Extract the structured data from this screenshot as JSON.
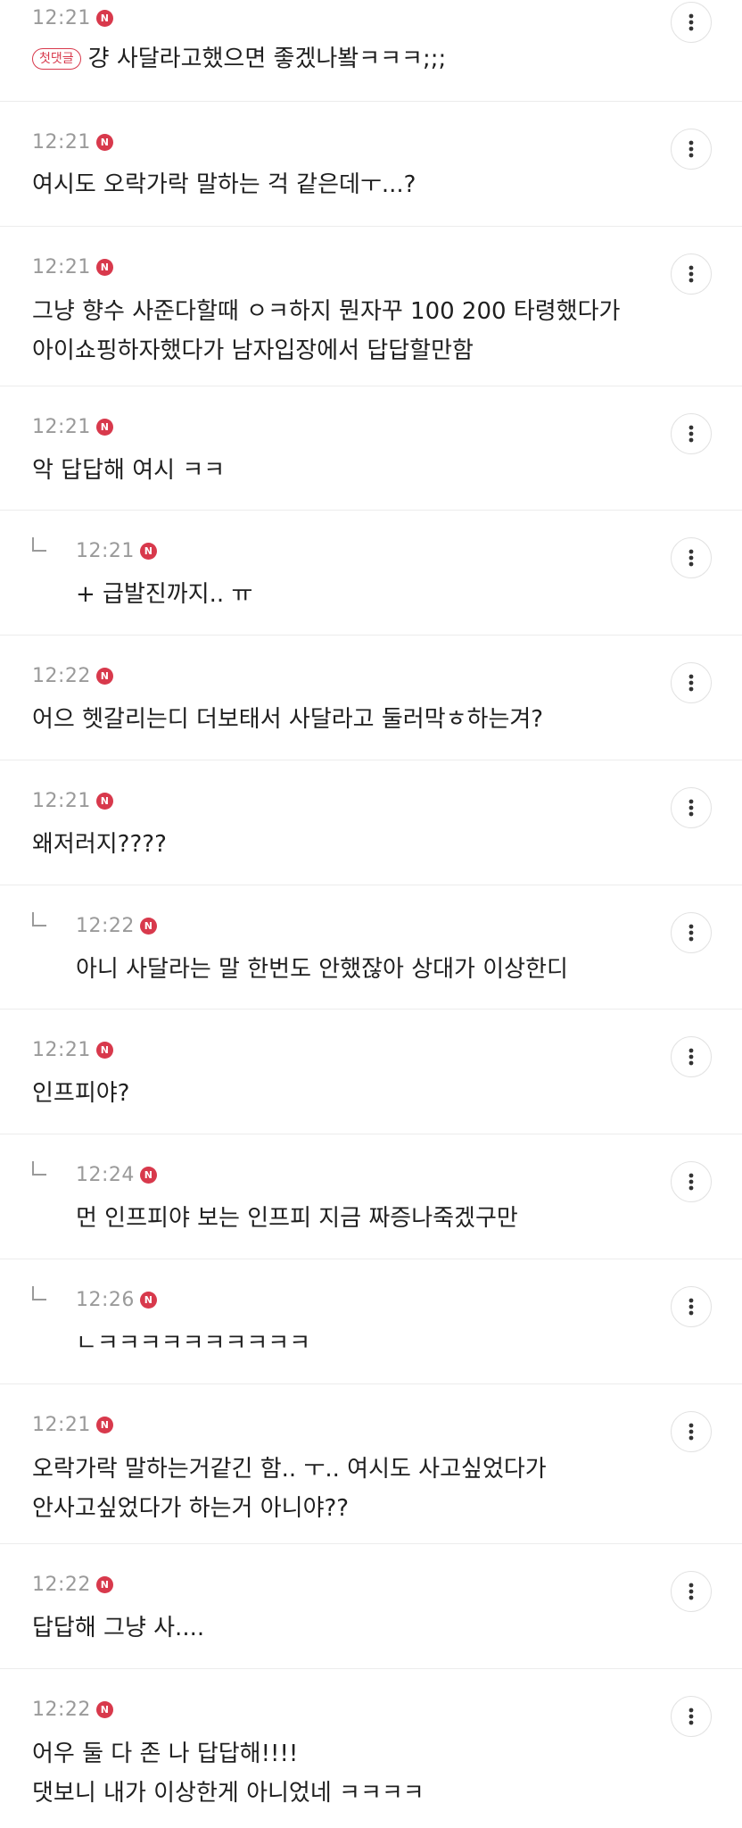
{
  "first_comment_badge": "첫댓글",
  "new_badge": "N",
  "comments": [
    {
      "time": "12:21",
      "text": "걍 사달라고했으면 좋겠나봨ㅋㅋㅋ;;;",
      "first": true
    },
    {
      "time": "12:21",
      "text": "여시도 오락가락 말하는 걱 같은데ㅜ...?"
    },
    {
      "time": "12:21",
      "lines": [
        "그냥 향수 사준다할때 ㅇㅋ하지 뭔자꾸 100 200 타령했다가",
        "아이쇼핑하자했다가 남자입장에서 답답할만함"
      ]
    },
    {
      "time": "12:21",
      "text": "악 답답해 여시 ㅋㅋ"
    },
    {
      "time": "12:21",
      "text": "+ 급발진까지.. ㅠ",
      "reply": true
    },
    {
      "time": "12:22",
      "text": "어으 헷갈리는디 더보태서 사달라고 둘러막ㅎ하는겨?"
    },
    {
      "time": "12:21",
      "text": "왜저러지????"
    },
    {
      "time": "12:22",
      "text": "아니 사달라는 말 한번도 안했잖아 상대가 이상한디",
      "reply": true
    },
    {
      "time": "12:21",
      "text": "인프피야?"
    },
    {
      "time": "12:24",
      "text": "먼 인프피야 보는 인프피 지금 짜증나죽겠구만",
      "reply": true
    },
    {
      "time": "12:26",
      "text": "ㄴㅋㅋㅋㅋㅋㅋㅋㅋㅋㅋ",
      "reply": true
    },
    {
      "time": "12:21",
      "lines": [
        "오락가락 말하는거같긴 함.. ㅜ.. 여시도 사고싶었다가",
        "안사고싶었다가 하는거 아니야??"
      ]
    },
    {
      "time": "12:22",
      "text": "답답해 그냥 사...."
    },
    {
      "time": "12:22",
      "lines": [
        "어우 둘 다 존 나 답답해!!!!",
        "댓보니 내가 이상한게 아니었네 ㅋㅋㅋㅋ"
      ]
    }
  ]
}
